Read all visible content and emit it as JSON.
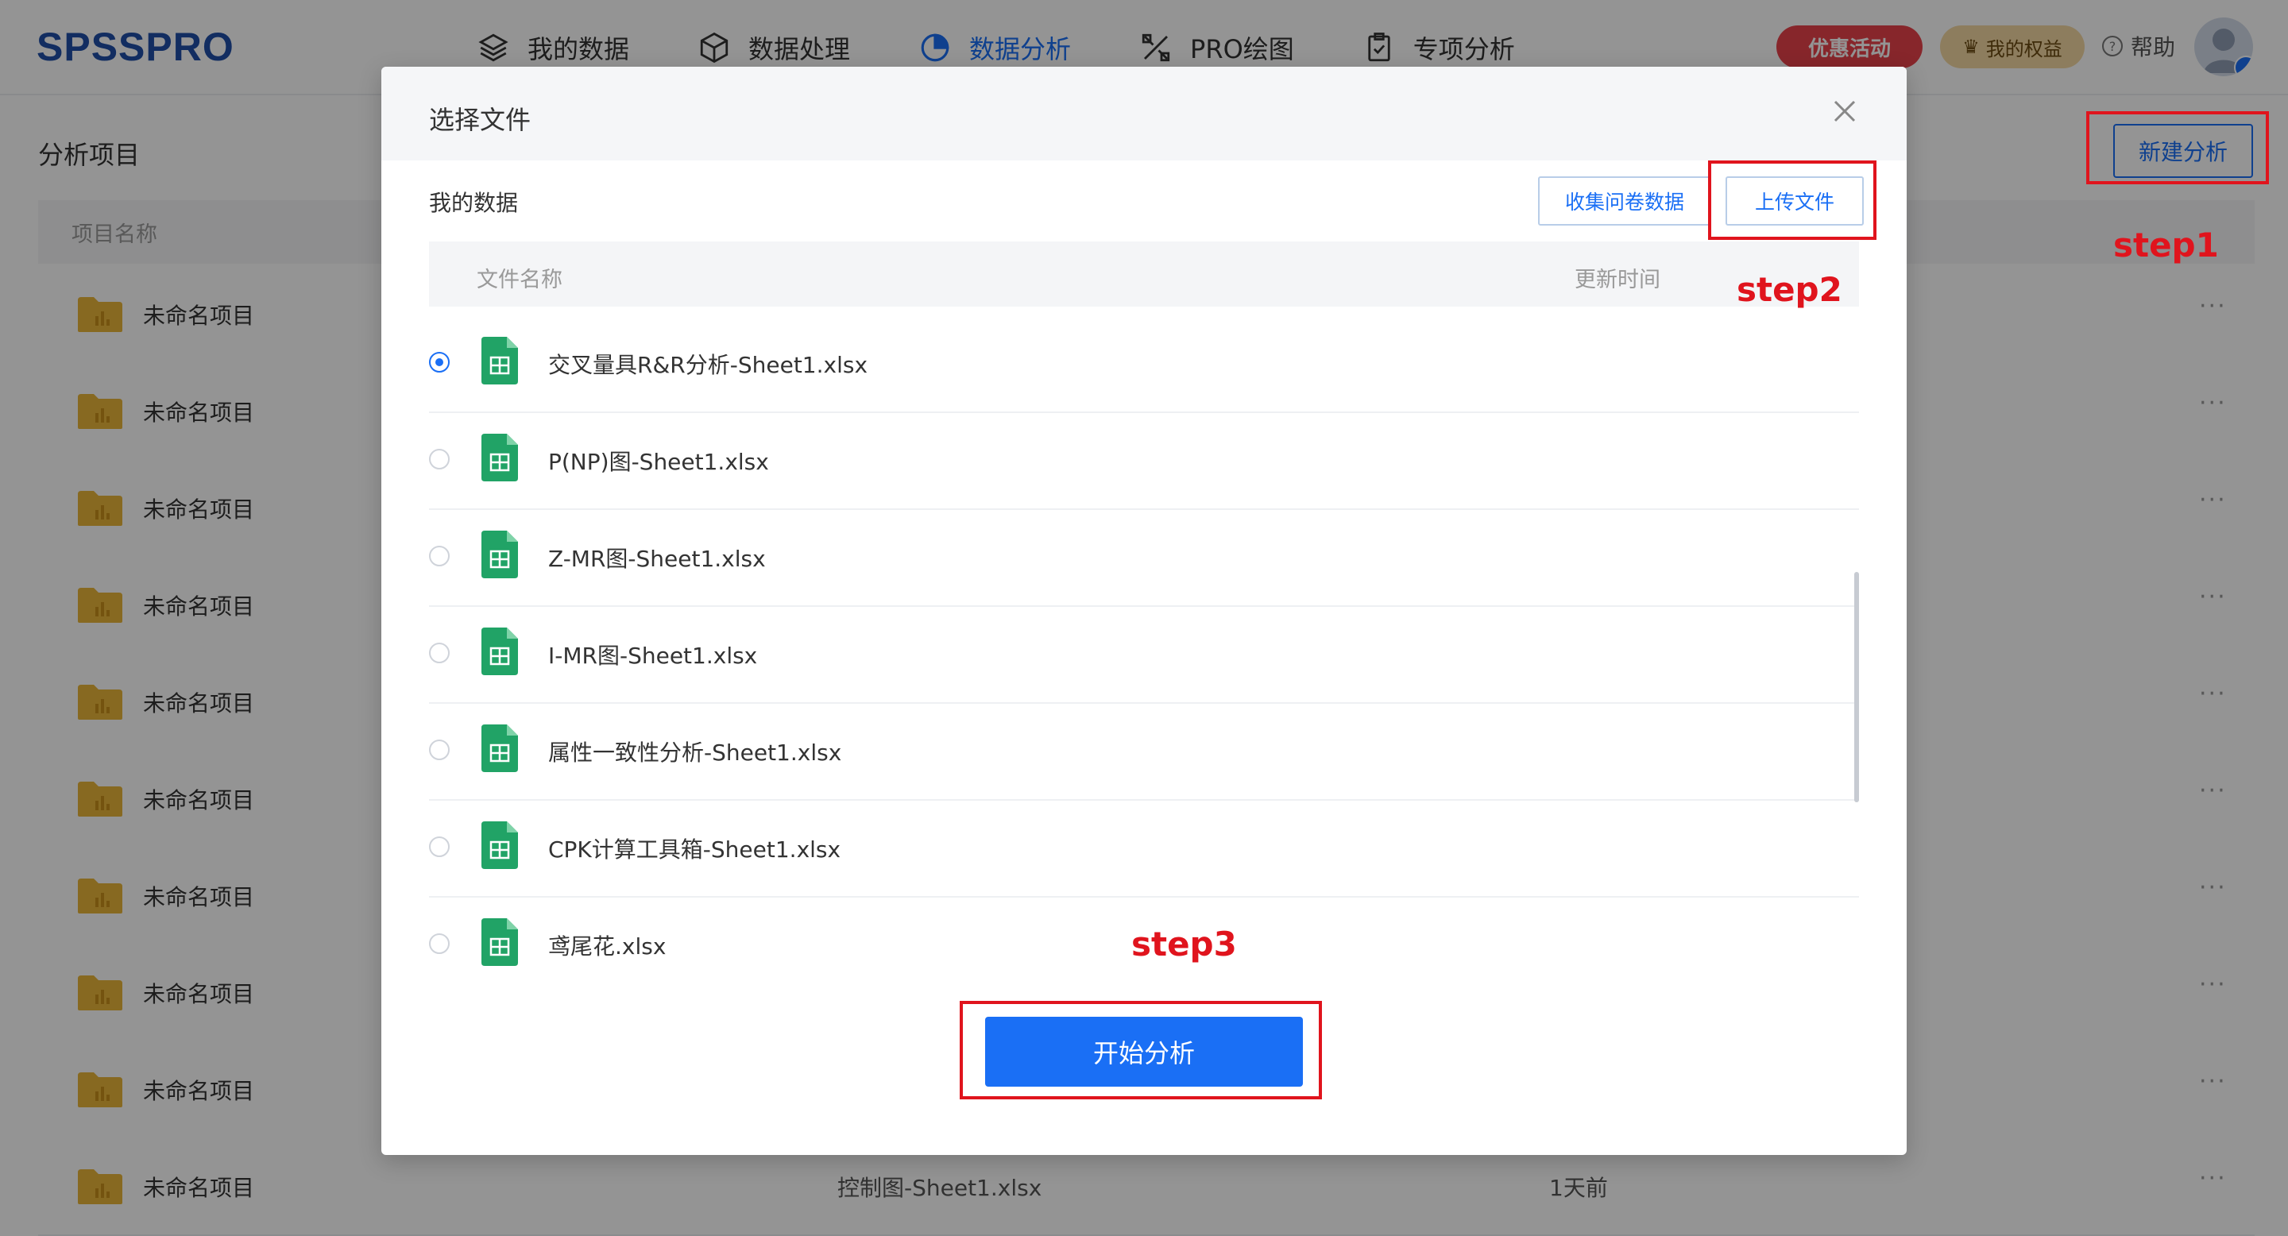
{
  "header": {
    "logo": "SPSSPRO",
    "nav": [
      {
        "label": "我的数据",
        "icon": "layers-icon"
      },
      {
        "label": "数据处理",
        "icon": "cube-icon"
      },
      {
        "label": "数据分析",
        "icon": "pie-chart-icon",
        "active": true
      },
      {
        "label": "PRO绘图",
        "icon": "draw-tools-icon"
      },
      {
        "label": "专项分析",
        "icon": "clipboard-check-icon"
      }
    ],
    "promo_label": "优惠活动",
    "rights_label": "我的权益",
    "help_label": "帮助"
  },
  "page": {
    "title": "分析项目",
    "new_button": "新建分析",
    "column_name": "项目名称",
    "rows": [
      {
        "name": "未命名项目"
      },
      {
        "name": "未命名项目"
      },
      {
        "name": "未命名项目"
      },
      {
        "name": "未命名项目"
      },
      {
        "name": "未命名项目"
      },
      {
        "name": "未命名项目"
      },
      {
        "name": "未命名项目"
      },
      {
        "name": "未命名项目"
      },
      {
        "name": "未命名项目"
      },
      {
        "name": "未命名项目",
        "file": "控制图-Sheet1.xlsx",
        "time": "1天前"
      }
    ],
    "more_glyph": "···"
  },
  "modal": {
    "title": "选择文件",
    "section_label": "我的数据",
    "collect_button": "收集问卷数据",
    "upload_button": "上传文件",
    "col_file_name": "文件名称",
    "col_update_time": "更新时间",
    "files": [
      {
        "name": "交叉量具R&R分析-Sheet1.xlsx",
        "selected": true
      },
      {
        "name": "P(NP)图-Sheet1.xlsx",
        "selected": false
      },
      {
        "name": "Z-MR图-Sheet1.xlsx",
        "selected": false
      },
      {
        "name": "I-MR图-Sheet1.xlsx",
        "selected": false
      },
      {
        "name": "属性一致性分析-Sheet1.xlsx",
        "selected": false
      },
      {
        "name": "CPK计算工具箱-Sheet1.xlsx",
        "selected": false
      },
      {
        "name": "鸢尾花.xlsx",
        "selected": false
      }
    ],
    "start_button": "开始分析"
  },
  "annotations": {
    "step1": "step1",
    "step2": "step2",
    "step3": "step3",
    "color": "#e0141d"
  },
  "colors": {
    "accent": "#1a6ff5",
    "promo": "#e9424a",
    "rights": "#f3d8a3",
    "sheet_icon": "#21a366",
    "folder": "#e8b53a"
  }
}
